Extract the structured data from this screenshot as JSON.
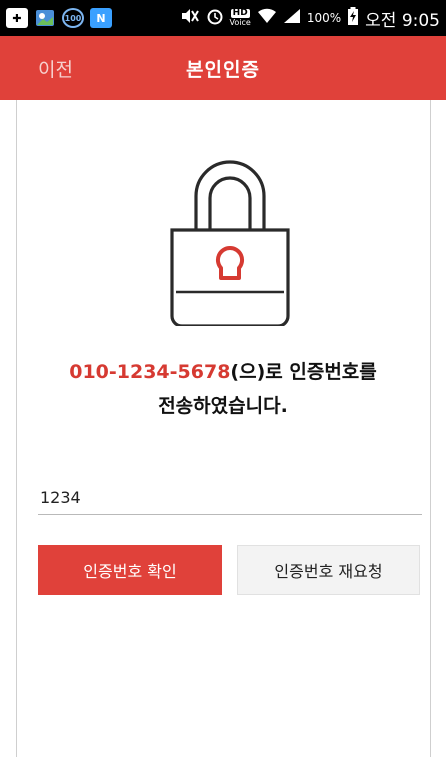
{
  "status_bar": {
    "icons": [
      "notification-plus-icon",
      "photo-icon",
      "badge-100-icon",
      "naver-n-icon",
      "mute-icon",
      "alarm-icon",
      "hd-voice-icon",
      "wifi-icon",
      "signal-icon",
      "battery-icon"
    ],
    "hd_label": "HD",
    "voice_label": "Voice",
    "battery_pct": "100%",
    "time": "오전 9:05",
    "badge_100": "100",
    "n_label": "N"
  },
  "app_bar": {
    "back_label": "이전",
    "title": "본인인증",
    "color": "#e0413a"
  },
  "message": {
    "phone": "010-1234-5678",
    "line1_suffix": "(으)로 인증번호를",
    "line2": "전송하였습니다."
  },
  "code_input": {
    "value": "1234"
  },
  "buttons": {
    "confirm_label": "인증번호 확인",
    "resend_label": "인증번호 재요청"
  }
}
